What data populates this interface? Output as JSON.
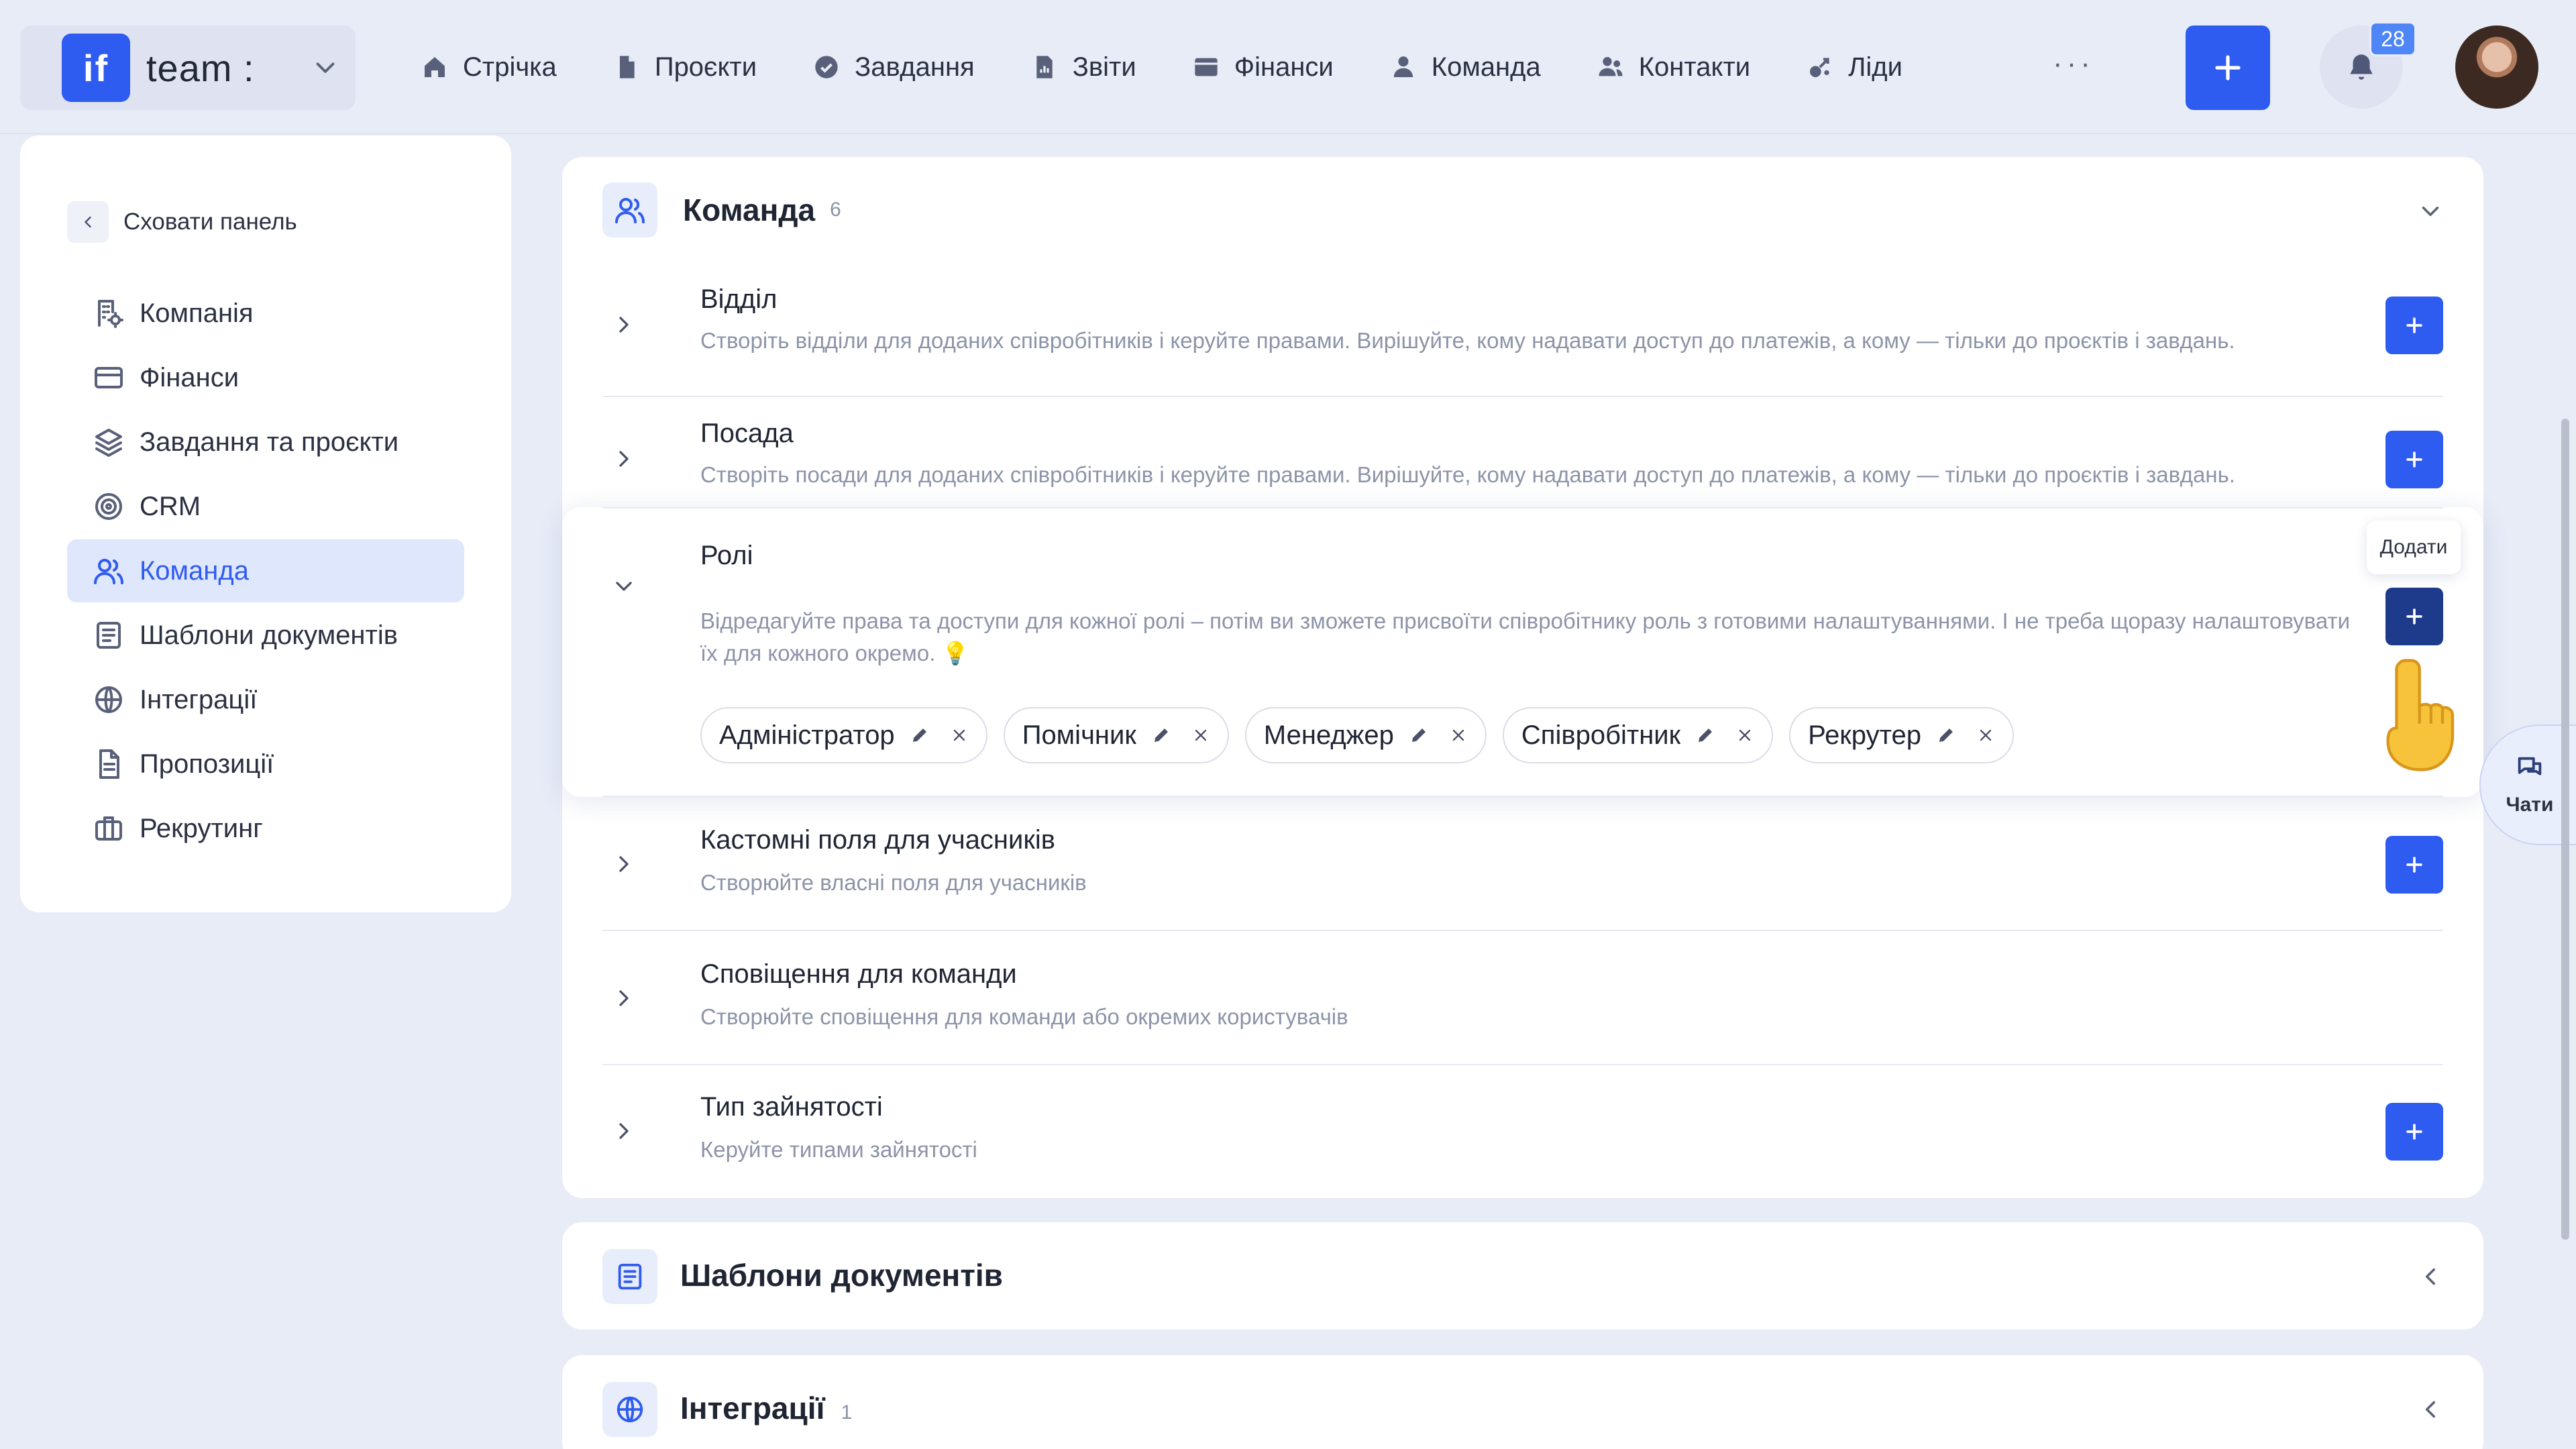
{
  "brand": {
    "logo": "if",
    "name": "team :",
    "chevron_icon": "chevron-down-icon"
  },
  "nav": [
    {
      "label": "Стрічка",
      "icon": "home-icon"
    },
    {
      "label": "Проєкти",
      "icon": "file-icon"
    },
    {
      "label": "Завдання",
      "icon": "check-circle-icon"
    },
    {
      "label": "Звіти",
      "icon": "report-icon"
    },
    {
      "label": "Фінанси",
      "icon": "wallet-icon"
    },
    {
      "label": "Команда",
      "icon": "user-icon"
    },
    {
      "label": "Контакти",
      "icon": "contacts-icon"
    },
    {
      "label": "Ліди",
      "icon": "leads-icon"
    }
  ],
  "nav_more": "···",
  "notifications": {
    "count": "28"
  },
  "sidebar": {
    "hide_label": "Сховати панель",
    "items": [
      {
        "label": "Компанія",
        "icon": "company-icon",
        "active": false
      },
      {
        "label": "Фінанси",
        "icon": "card-icon",
        "active": false
      },
      {
        "label": "Завдання та проєкти",
        "icon": "layers-icon",
        "active": false
      },
      {
        "label": "CRM",
        "icon": "target-icon",
        "active": false
      },
      {
        "label": "Команда",
        "icon": "users-icon",
        "active": true
      },
      {
        "label": "Шаблони документів",
        "icon": "document-icon",
        "active": false
      },
      {
        "label": "Інтеграції",
        "icon": "globe-icon",
        "active": false
      },
      {
        "label": "Пропозиції",
        "icon": "proposal-icon",
        "active": false
      },
      {
        "label": "Рекрутинг",
        "icon": "briefcase-icon",
        "active": false
      }
    ]
  },
  "team": {
    "title": "Команда",
    "count": "6",
    "rows": [
      {
        "title": "Відділ",
        "desc": "Створіть відділи для доданих співробітників і керуйте правами. Вирішуйте, кому надавати доступ до платежів, а кому — тільки до проєктів і завдань."
      },
      {
        "title": "Посада",
        "desc": "Створіть посади для доданих співробітників і керуйте правами. Вирішуйте, кому надавати доступ до платежів, а кому — тільки до проєктів і завдань."
      },
      {
        "title": "Ролі",
        "desc": "Відредагуйте права та доступи для кожної ролі – потім ви зможете присвоїти співробітнику роль з готовими налаштуваннями. І не треба щоразу налаштовувати їх для кожного окремо. 💡"
      },
      {
        "title": "Кастомні поля для учасників",
        "desc": "Створюйте власні поля для учасників"
      },
      {
        "title": "Сповіщення для команди",
        "desc": "Створюйте сповіщення для команди або окремих користувачів"
      },
      {
        "title": "Тип зайнятості",
        "desc": "Керуйте типами зайнятості"
      }
    ],
    "roles": [
      "Адміністратор",
      "Помічник",
      "Менеджер",
      "Співробітник",
      "Рекрутер"
    ],
    "add_tooltip": "Додати"
  },
  "sections": [
    {
      "title": "Шаблони документів",
      "count": "",
      "icon": "document-icon"
    },
    {
      "title": "Інтеграції",
      "count": "1",
      "icon": "globe-icon"
    }
  ],
  "chats": {
    "label": "Чати",
    "icon": "chat-icon"
  },
  "colors": {
    "accent": "#2f5cf0",
    "accent_dark": "#1e3a8a",
    "badge": "#4e86f7",
    "background": "#e8ecf7"
  }
}
